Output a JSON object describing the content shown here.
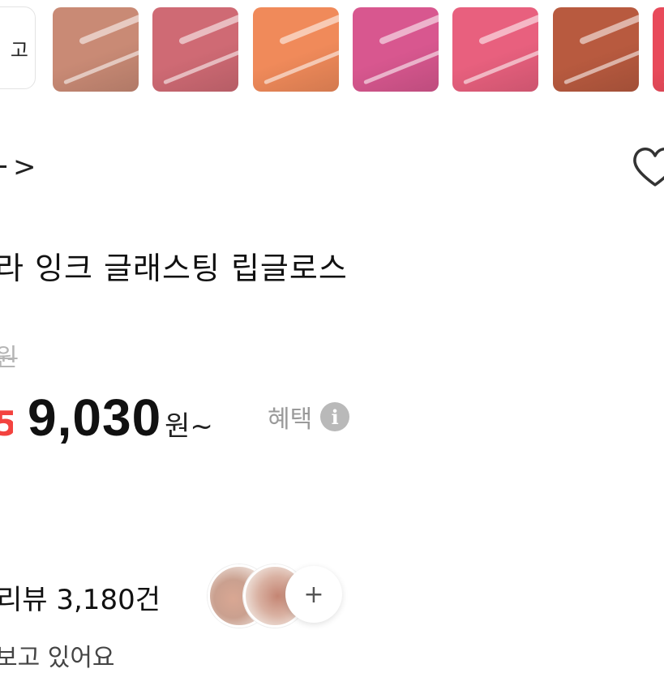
{
  "thumbs": {
    "more_label": "고",
    "swatch_colors": [
      "#c98a75",
      "#cf6a74",
      "#f08a5a",
      "#d8578f",
      "#e8607e",
      "#b85a3f",
      "#e84a5a"
    ]
  },
  "breadcrumb": {
    "arrow": ">"
  },
  "product": {
    "title": "라 잉크 글래스팅 립글로스",
    "original_price": "원",
    "discount": "5",
    "price": "9,030",
    "price_unit": "원~",
    "benefit_label": "혜택",
    "info_icon": "i"
  },
  "reviews": {
    "label": "리뷰 3,180건",
    "more_icon": "+"
  },
  "watching": "보고 있어요",
  "icons": {
    "heart": "heart-icon",
    "info": "info-icon",
    "plus": "plus-icon",
    "chevron": "chevron-right-icon"
  },
  "colors": {
    "discount": "#f3433f",
    "muted": "#9a9a9a"
  }
}
